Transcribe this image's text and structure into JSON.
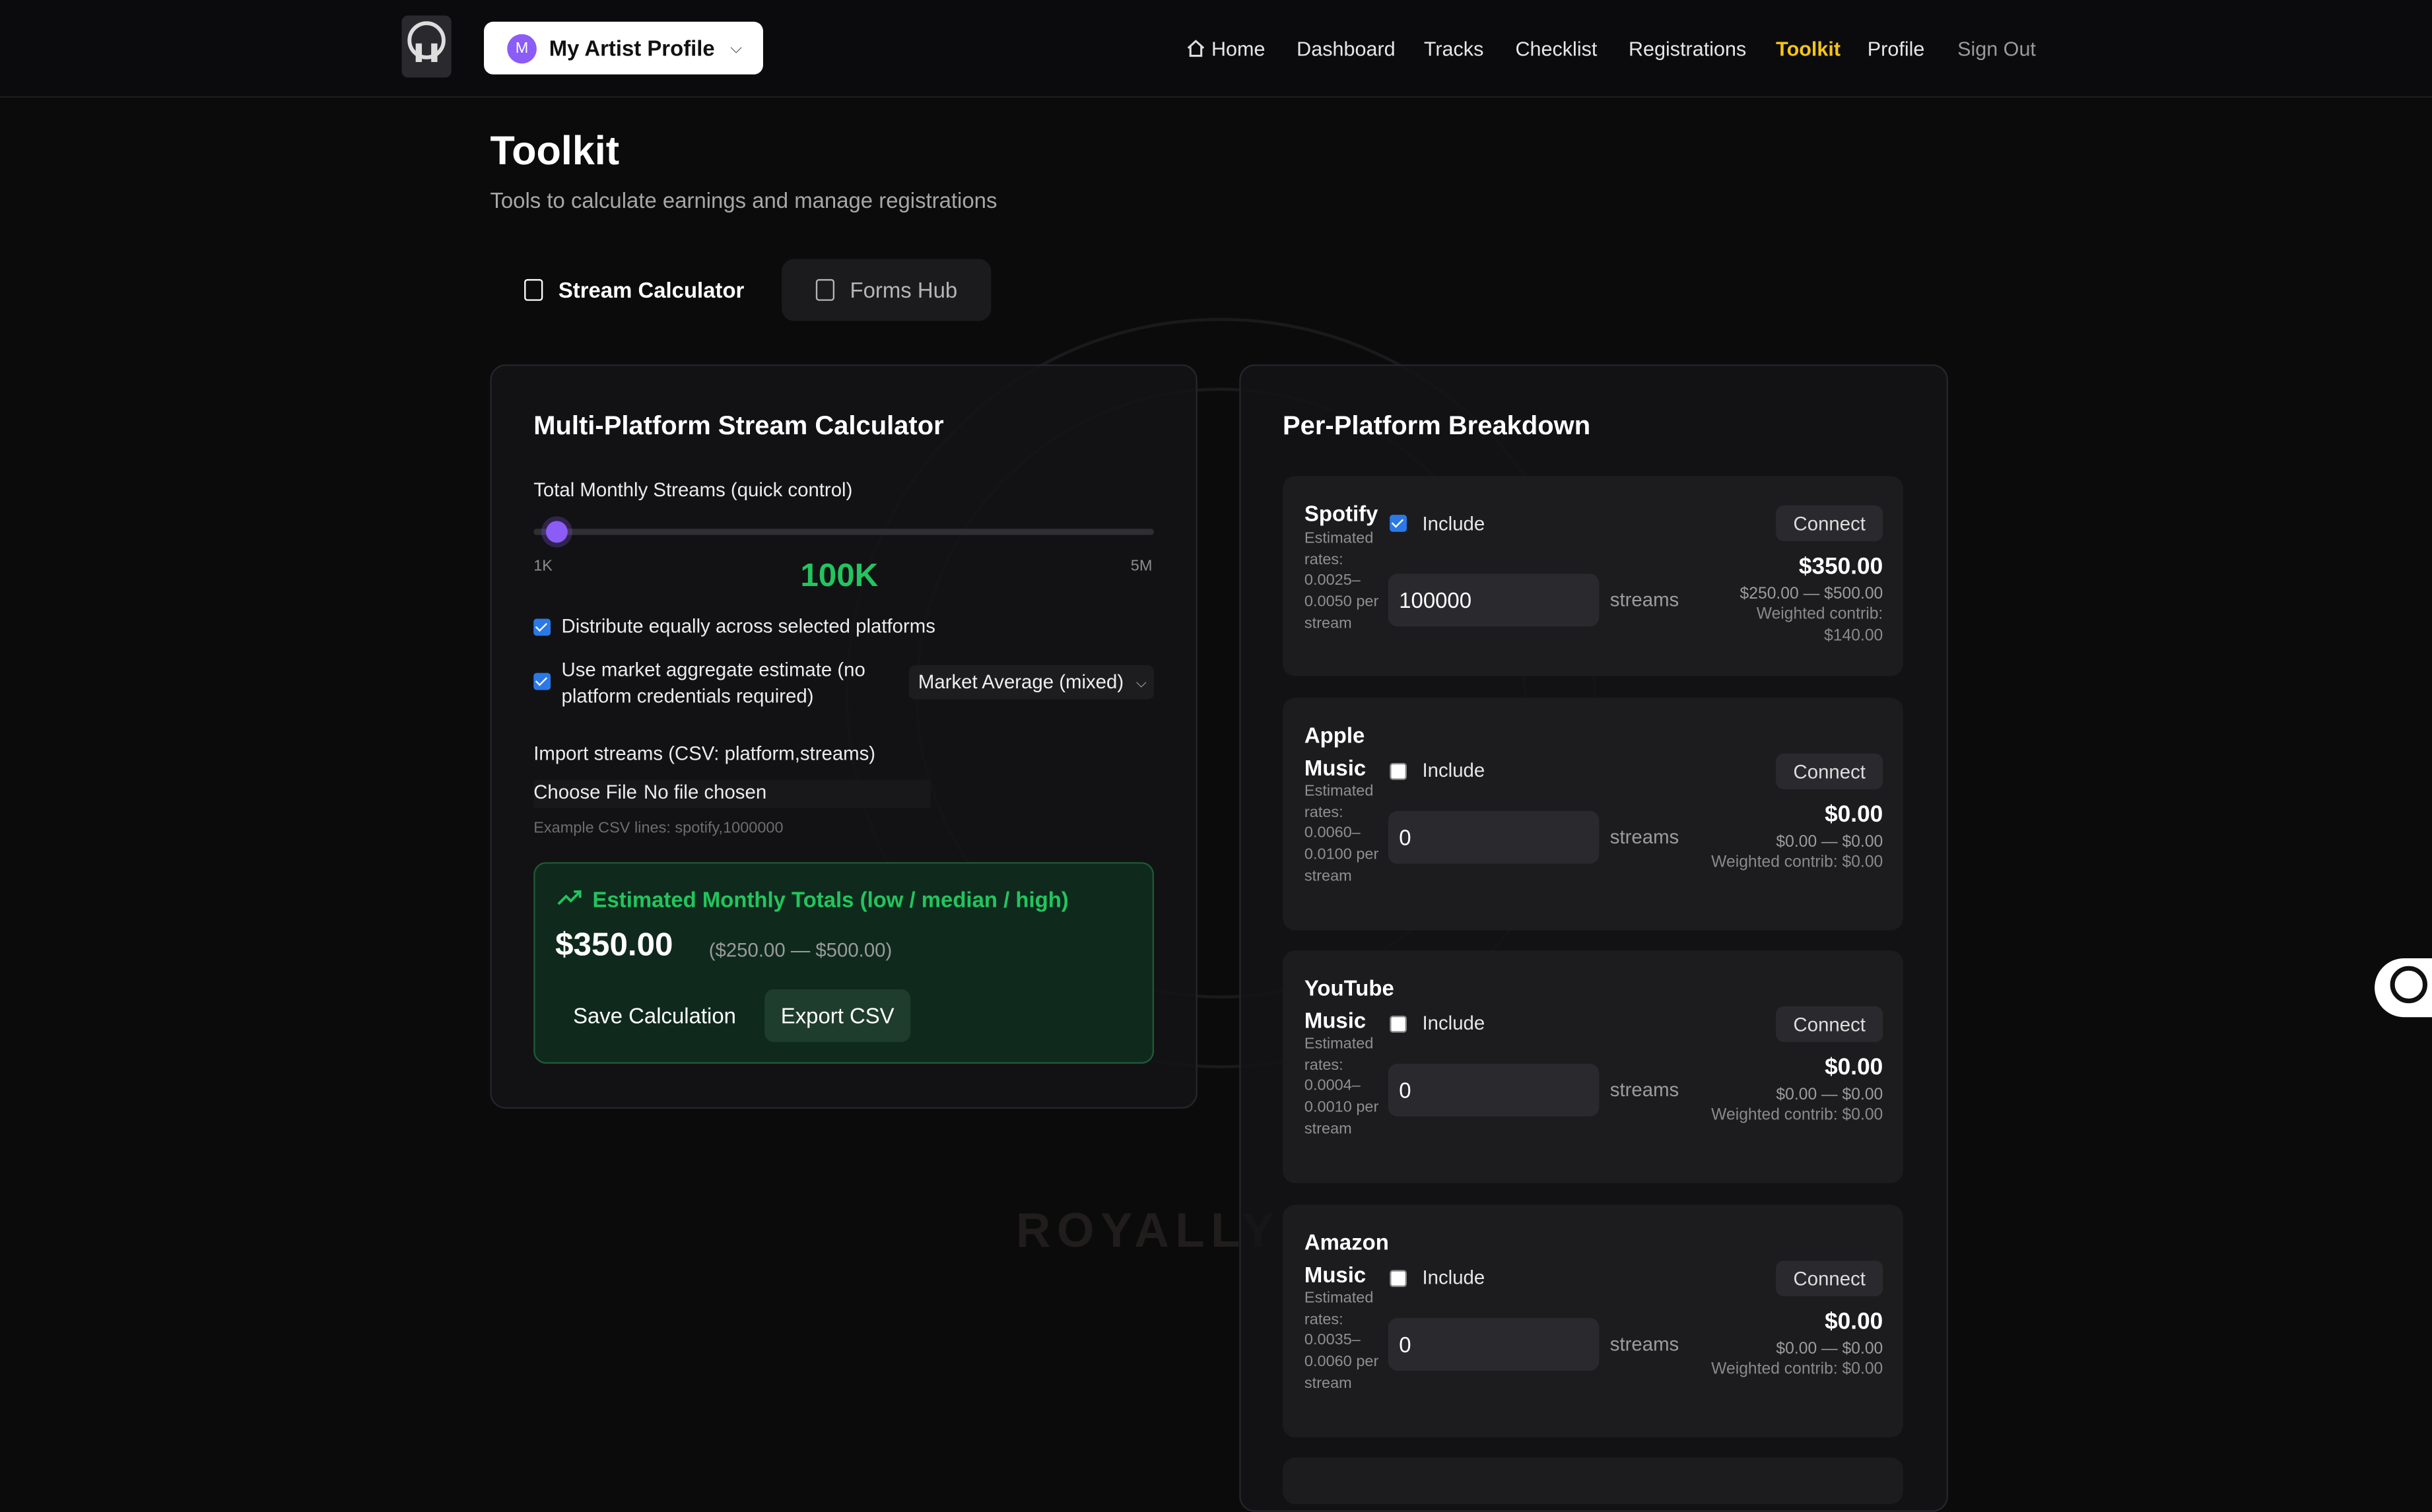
{
  "nav": {
    "profile_initial": "M",
    "profile_label": "My Artist Profile",
    "links": [
      "Home",
      "Dashboard",
      "Tracks",
      "Checklist",
      "Registrations",
      "Toolkit",
      "Profile",
      "Sign Out"
    ],
    "active": "Toolkit"
  },
  "page": {
    "title": "Toolkit",
    "subtitle": "Tools to calculate earnings and manage registrations",
    "tabs": [
      "Stream Calculator",
      "Forms Hub"
    ]
  },
  "watermark": "ROYALLY TUNED",
  "calculator": {
    "title": "Multi-Platform Stream Calculator",
    "streams_label": "Total Monthly Streams (quick control)",
    "slider_min": "1K",
    "slider_max": "5M",
    "slider_value": "100K",
    "slider_fraction": 0.02,
    "distribute_label": "Distribute equally across selected platforms",
    "distribute_checked": true,
    "aggregate_label": "Use market aggregate estimate (no platform credentials required)",
    "aggregate_checked": true,
    "market_select": "Market Average (mixed)",
    "import_label": "Import streams (CSV: platform,streams)",
    "file_button": "Choose File",
    "file_status": "No file chosen",
    "csv_example": "Example CSV lines: spotify,1000000",
    "estimate_title": "Estimated Monthly Totals (low / median / high)",
    "estimate_value": "$350.00",
    "estimate_range": "($250.00 — $500.00)",
    "save_button": "Save Calculation",
    "export_button": "Export CSV"
  },
  "breakdown": {
    "title": "Per-Platform Breakdown",
    "include_label": "Include",
    "connect_label": "Connect",
    "streams_label": "streams",
    "platforms": [
      {
        "name": "Spotify",
        "rate": "Estimated rates: 0.0025–0.0050 per stream",
        "included": true,
        "streams": "100000",
        "amount": "$350.00",
        "range": "$250.00 — $500.00",
        "weighted": "Weighted contrib: $140.00"
      },
      {
        "name": "Apple Music",
        "rate": "Estimated rates: 0.0060–0.0100 per stream",
        "included": false,
        "streams": "0",
        "amount": "$0.00",
        "range": "$0.00 — $0.00",
        "weighted": "Weighted contrib: $0.00"
      },
      {
        "name": "YouTube Music",
        "rate": "Estimated rates: 0.0004–0.0010 per stream",
        "included": false,
        "streams": "0",
        "amount": "$0.00",
        "range": "$0.00 — $0.00",
        "weighted": "Weighted contrib: $0.00"
      },
      {
        "name": "Amazon Music",
        "rate": "Estimated rates: 0.0035–0.0060 per stream",
        "included": false,
        "streams": "0",
        "amount": "$0.00",
        "range": "$0.00 — $0.00",
        "weighted": "Weighted contrib: $0.00"
      }
    ]
  }
}
